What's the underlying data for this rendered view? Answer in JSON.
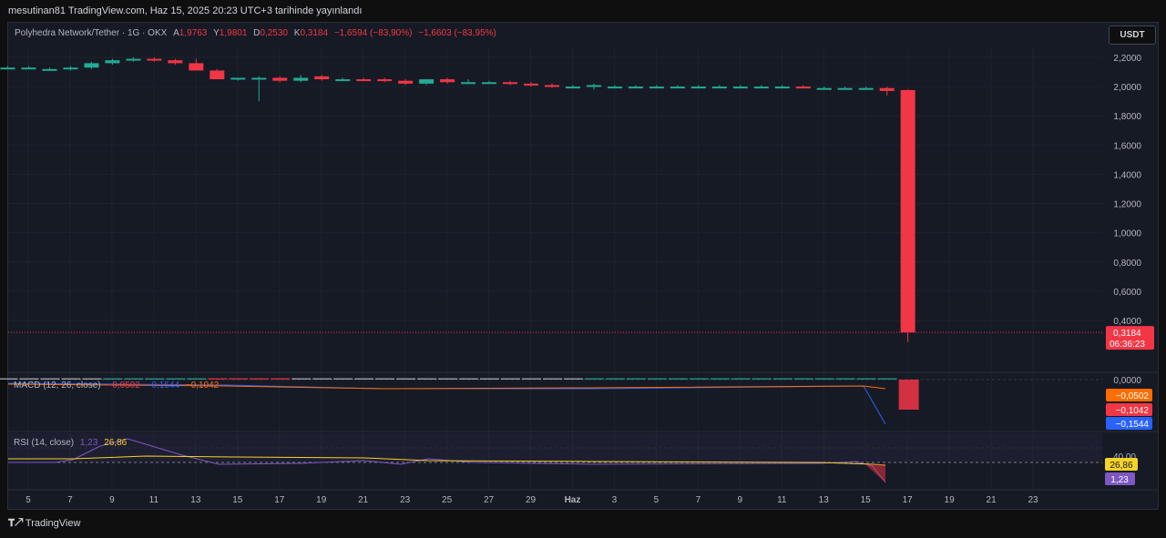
{
  "header": {
    "publish_text": "mesutinan81 TradingView.com, Haz 15, 2025 20:23 UTC+3 tarihinde yayınlandı"
  },
  "legend": {
    "symbol": "Polyhedra Network/Tether · 1G · OKX",
    "open_label": "A",
    "open": "1,9763",
    "high_label": "Y",
    "high": "1,9801",
    "low_label": "D",
    "low": "0,2530",
    "close_label": "K",
    "close": "0,3184",
    "change": "−1,6594 (−83,90%)",
    "change2": "−1,6603 (−83,95%)"
  },
  "currency_button": "USDT",
  "price_tag": {
    "price": "0,3184",
    "countdown": "06:36:23"
  },
  "macd": {
    "title": "MACD (12, 26, close)",
    "macd_value": "−0,1042",
    "signal_value": "−0,1544",
    "hist_value": "−0,0502",
    "zero_label": "0,0000"
  },
  "rsi": {
    "title": "RSI (14, close)",
    "value": "1,23",
    "ma_value": "26,86",
    "level_label": "40,00"
  },
  "footer": {
    "brand": "TradingView"
  },
  "colors": {
    "up": "#22ab94",
    "down": "#f23645",
    "bg": "#161a25",
    "macd": "#2962ff",
    "signal": "#ff6d00",
    "rsi": "#7e57c2",
    "rsi_ma": "#f5d327"
  },
  "chart_data": {
    "type": "candlestick",
    "x_tick_labels": [
      "5",
      "7",
      "9",
      "11",
      "13",
      "15",
      "17",
      "19",
      "21",
      "23",
      "25",
      "27",
      "29",
      "Haz",
      "3",
      "5",
      "7",
      "9",
      "11",
      "13",
      "15",
      "17",
      "19",
      "21",
      "23"
    ],
    "y_tick_labels": [
      "2,2000",
      "2,0000",
      "1,8000",
      "1,6000",
      "1,4000",
      "1,2000",
      "1,0000",
      "0,8000",
      "0,6000",
      "0,4000"
    ],
    "ylim": [
      0.24,
      2.35
    ],
    "candles": [
      {
        "d": "Mayıs 4",
        "o": 2.13,
        "h": 2.14,
        "l": 2.12,
        "c": 2.13
      },
      {
        "d": "Mayıs 5",
        "o": 2.13,
        "h": 2.14,
        "l": 2.12,
        "c": 2.13
      },
      {
        "d": "Mayıs 6",
        "o": 2.12,
        "h": 2.13,
        "l": 2.11,
        "c": 2.12
      },
      {
        "d": "Mayıs 7",
        "o": 2.12,
        "h": 2.14,
        "l": 2.11,
        "c": 2.13
      },
      {
        "d": "Mayıs 8",
        "o": 2.13,
        "h": 2.17,
        "l": 2.12,
        "c": 2.16
      },
      {
        "d": "Mayıs 9",
        "o": 2.16,
        "h": 2.19,
        "l": 2.15,
        "c": 2.18
      },
      {
        "d": "Mayıs 10",
        "o": 2.18,
        "h": 2.2,
        "l": 2.17,
        "c": 2.19
      },
      {
        "d": "Mayıs 11",
        "o": 2.19,
        "h": 2.2,
        "l": 2.17,
        "c": 2.18
      },
      {
        "d": "Mayıs 12",
        "o": 2.18,
        "h": 2.19,
        "l": 2.15,
        "c": 2.16
      },
      {
        "d": "Mayıs 13",
        "o": 2.16,
        "h": 2.19,
        "l": 2.11,
        "c": 2.11
      },
      {
        "d": "Mayıs 14",
        "o": 2.11,
        "h": 2.12,
        "l": 2.05,
        "c": 2.05
      },
      {
        "d": "Mayıs 15",
        "o": 2.05,
        "h": 2.06,
        "l": 2.04,
        "c": 2.06
      },
      {
        "d": "Mayıs 16",
        "o": 2.05,
        "h": 2.07,
        "l": 1.9,
        "c": 2.06
      },
      {
        "d": "Mayıs 17",
        "o": 2.06,
        "h": 2.07,
        "l": 2.03,
        "c": 2.04
      },
      {
        "d": "Mayıs 18",
        "o": 2.04,
        "h": 2.08,
        "l": 2.03,
        "c": 2.06
      },
      {
        "d": "Mayıs 19",
        "o": 2.07,
        "h": 2.08,
        "l": 2.04,
        "c": 2.05
      },
      {
        "d": "Mayıs 20",
        "o": 2.05,
        "h": 2.06,
        "l": 2.04,
        "c": 2.05
      },
      {
        "d": "Mayıs 21",
        "o": 2.05,
        "h": 2.06,
        "l": 2.04,
        "c": 2.04
      },
      {
        "d": "Mayıs 22",
        "o": 2.05,
        "h": 2.06,
        "l": 2.03,
        "c": 2.04
      },
      {
        "d": "Mayıs 23",
        "o": 2.04,
        "h": 2.05,
        "l": 2.01,
        "c": 2.02
      },
      {
        "d": "Mayıs 24",
        "o": 2.02,
        "h": 2.05,
        "l": 2.01,
        "c": 2.05
      },
      {
        "d": "Mayıs 25",
        "o": 2.05,
        "h": 2.06,
        "l": 2.02,
        "c": 2.03
      },
      {
        "d": "Mayıs 26",
        "o": 2.03,
        "h": 2.05,
        "l": 2.02,
        "c": 2.03
      },
      {
        "d": "Mayıs 27",
        "o": 2.03,
        "h": 2.04,
        "l": 2.02,
        "c": 2.03
      },
      {
        "d": "Mayıs 28",
        "o": 2.03,
        "h": 2.04,
        "l": 2.01,
        "c": 2.02
      },
      {
        "d": "Mayıs 29",
        "o": 2.02,
        "h": 2.03,
        "l": 2.0,
        "c": 2.01
      },
      {
        "d": "Mayıs 30",
        "o": 2.01,
        "h": 2.02,
        "l": 1.99,
        "c": 2.0
      },
      {
        "d": "Mayıs 31",
        "o": 2.0,
        "h": 2.01,
        "l": 1.99,
        "c": 2.0
      },
      {
        "d": "Haz 1",
        "o": 2.0,
        "h": 2.02,
        "l": 1.98,
        "c": 2.01
      },
      {
        "d": "Haz 2",
        "o": 2.0,
        "h": 2.01,
        "l": 1.99,
        "c": 2.0
      },
      {
        "d": "Haz 3",
        "o": 2.0,
        "h": 2.01,
        "l": 1.99,
        "c": 2.0
      },
      {
        "d": "Haz 4",
        "o": 2.0,
        "h": 2.01,
        "l": 1.99,
        "c": 2.0
      },
      {
        "d": "Haz 5",
        "o": 2.0,
        "h": 2.01,
        "l": 1.99,
        "c": 2.0
      },
      {
        "d": "Haz 6",
        "o": 2.0,
        "h": 2.01,
        "l": 1.99,
        "c": 2.0
      },
      {
        "d": "Haz 7",
        "o": 2.0,
        "h": 2.01,
        "l": 1.99,
        "c": 2.0
      },
      {
        "d": "Haz 8",
        "o": 2.0,
        "h": 2.01,
        "l": 1.99,
        "c": 2.0
      },
      {
        "d": "Haz 9",
        "o": 2.0,
        "h": 2.01,
        "l": 1.99,
        "c": 2.0
      },
      {
        "d": "Haz 10",
        "o": 2.0,
        "h": 2.01,
        "l": 1.99,
        "c": 2.0
      },
      {
        "d": "Haz 11",
        "o": 2.0,
        "h": 2.01,
        "l": 1.99,
        "c": 1.99
      },
      {
        "d": "Haz 12",
        "o": 1.99,
        "h": 2.0,
        "l": 1.98,
        "c": 1.99
      },
      {
        "d": "Haz 13",
        "o": 1.99,
        "h": 2.0,
        "l": 1.98,
        "c": 1.99
      },
      {
        "d": "Haz 14",
        "o": 1.99,
        "h": 2.0,
        "l": 1.98,
        "c": 1.99
      },
      {
        "d": "Haz 15",
        "o": 1.99,
        "h": 2.0,
        "l": 1.94,
        "c": 1.97
      },
      {
        "d": "Haz 16",
        "o": 1.9763,
        "h": 1.9801,
        "l": 0.253,
        "c": 0.3184
      }
    ]
  }
}
